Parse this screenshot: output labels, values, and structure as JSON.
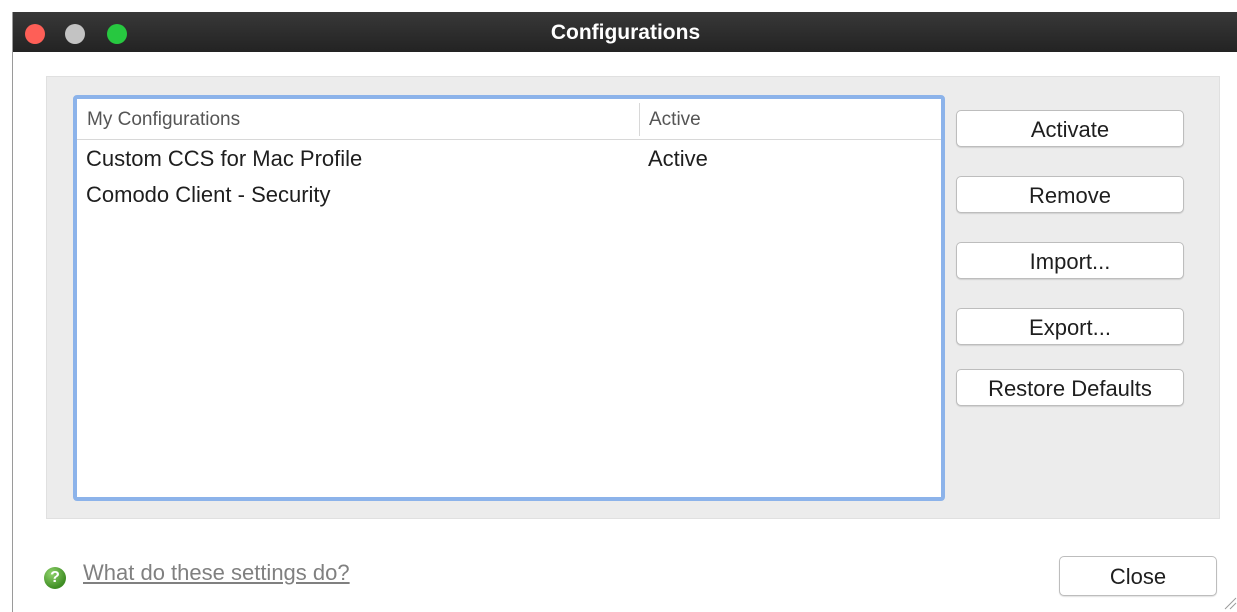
{
  "window": {
    "title": "Configurations",
    "controls": {
      "close_color": "#fe5f57",
      "minimize_color": "#c3c3c3",
      "zoom_color": "#27c840"
    }
  },
  "list": {
    "columns": [
      "My Configurations",
      "Active"
    ],
    "rows": [
      {
        "name": "Custom CCS for Mac Profile",
        "active": "Active"
      },
      {
        "name": "Comodo Client - Security",
        "active": ""
      }
    ],
    "focus_color": "#8cb3ea"
  },
  "buttons": {
    "activate": "Activate",
    "remove": "Remove",
    "import": "Import...",
    "export": "Export...",
    "restore_defaults": "Restore Defaults"
  },
  "footer": {
    "help_icon": "question-icon",
    "help_link": "What do these settings do?",
    "close": "Close"
  }
}
